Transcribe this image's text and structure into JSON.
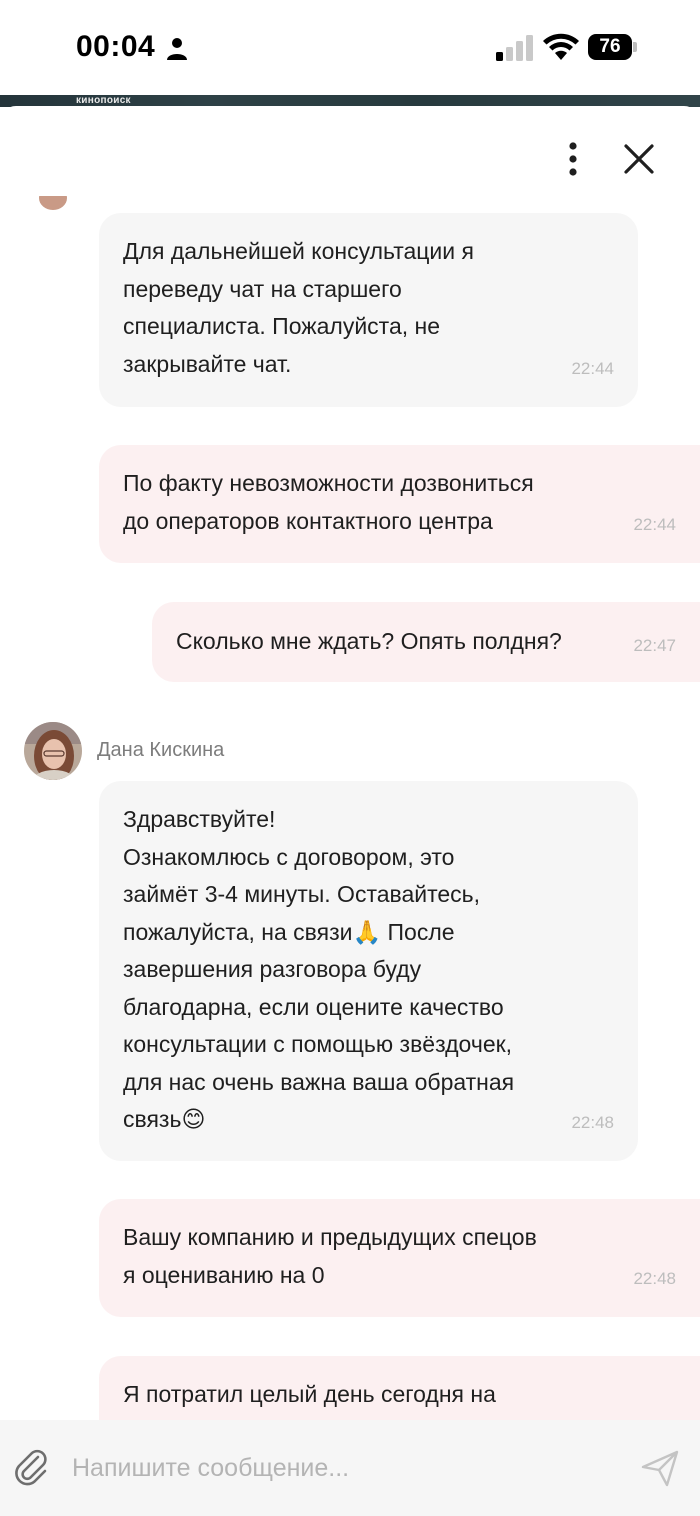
{
  "status_bar": {
    "time": "00:04",
    "battery": "76",
    "icons": [
      "person-icon",
      "cellular-signal-icon",
      "wifi-icon",
      "battery-icon"
    ]
  },
  "banner": {
    "text": "кинопоиск"
  },
  "header": {
    "icons": [
      "more-vertical-icon",
      "close-icon"
    ]
  },
  "messages": [
    {
      "direction": "incoming",
      "text": "Для дальнейшей консультации я\nпереведу чат на старшего\nспециалиста. Пожалуйста, не\nзакрывайте чат.",
      "time": "22:44"
    },
    {
      "direction": "outgoing",
      "text": "По факту невозможности дозвониться\nдо операторов контактного центра",
      "time": "22:44"
    },
    {
      "direction": "outgoing",
      "text": "Сколько мне ждать? Опять полдня?",
      "time": "22:47"
    },
    {
      "direction": "incoming",
      "sender": "Дана Кискина",
      "text": "Здравствуйте!\nОзнакомлюсь с договором, это\nзаймёт 3-4 минуты. Оставайтесь,\nпожалуйста, на связи🙏 После\nзавершения разговора буду\nблагодарна, если оцените качество\nконсультации с помощью звёздочек,\nдля нас очень важна ваша обратная\nсвязь😊",
      "time": "22:48"
    },
    {
      "direction": "outgoing",
      "text": "Вашу компанию и предыдущих спецов\nя оцениванию на 0",
      "time": "22:48"
    },
    {
      "direction": "outgoing",
      "text": "Я потратил целый день сегодня на",
      "time": ""
    }
  ],
  "composer": {
    "placeholder": "Напишите сообщение...",
    "icons": [
      "attach-icon",
      "send-icon"
    ]
  },
  "colors": {
    "incoming_bubble": "#f6f6f6",
    "outgoing_bubble": "#fcf0f1",
    "timestamp": "#bdbdbd",
    "sender_name": "#7d7d7d"
  }
}
